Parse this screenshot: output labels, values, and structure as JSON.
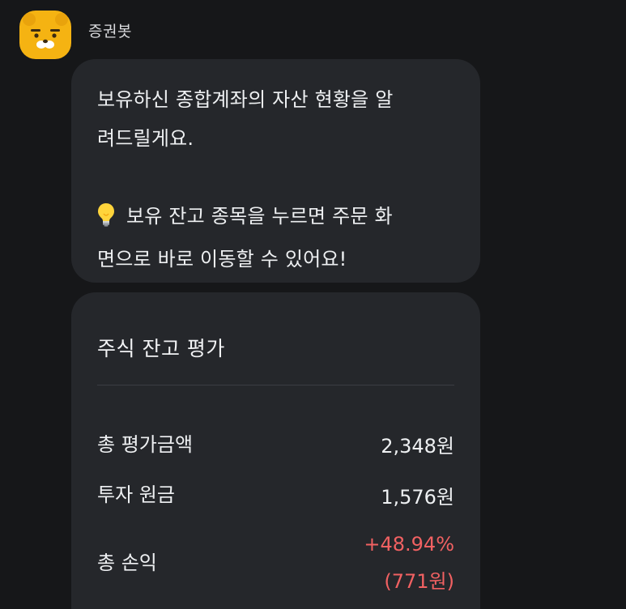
{
  "bot": {
    "name": "증권봇",
    "avatar_icon": "ryan-face-icon",
    "avatar_color": "#f5b312"
  },
  "message": {
    "line1": "보유하신 종합계좌의 자산 현황을 알",
    "line2": "려드릴게요.",
    "tip_icon": "lightbulb-icon",
    "line3": "보유 잔고 종목을 누르면 주문 화",
    "line4": "면으로 바로 이동할 수 있어요!"
  },
  "balance_card": {
    "title": "주식 잔고 평가",
    "rows": [
      {
        "label": "총 평가금액",
        "value": "2,348원"
      },
      {
        "label": "투자 원금",
        "value": "1,576원"
      },
      {
        "label": "총 손익",
        "value": "+48.94%",
        "sub_value": "(771원)"
      }
    ]
  },
  "colors": {
    "background": "#161719",
    "bubble": "#25272b",
    "profit_red": "#f16162"
  }
}
